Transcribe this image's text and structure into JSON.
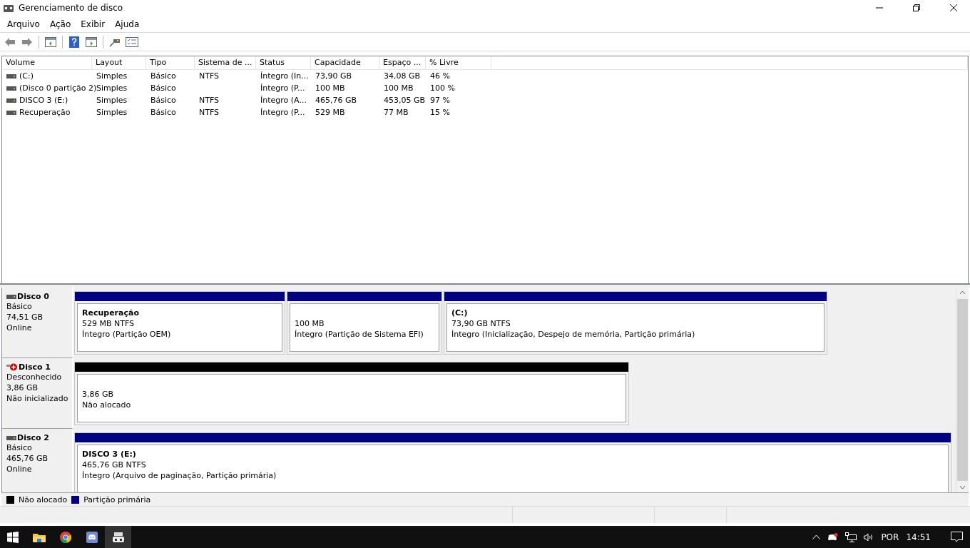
{
  "window": {
    "title": "Gerenciamento de disco"
  },
  "menu": [
    "Arquivo",
    "Ação",
    "Exibir",
    "Ajuda"
  ],
  "table": {
    "columns": [
      "Volume",
      "Layout",
      "Tipo",
      "Sistema de ...",
      "Status",
      "Capacidade",
      "Espaço ...",
      "% Livre"
    ],
    "rows": [
      [
        "(C:)",
        "Simples",
        "Básico",
        "NTFS",
        "Íntegro (In...",
        "73,90 GB",
        "34,08 GB",
        "46 %"
      ],
      [
        "(Disco 0 partição 2)",
        "Simples",
        "Básico",
        "",
        "Íntegro (P...",
        "100 MB",
        "100 MB",
        "100 %"
      ],
      [
        "DISCO 3 (E:)",
        "Simples",
        "Básico",
        "NTFS",
        "Íntegro (A...",
        "465,76 GB",
        "453,05 GB",
        "97 %"
      ],
      [
        "Recuperação",
        "Simples",
        "Básico",
        "NTFS",
        "Íntegro (P...",
        "529 MB",
        "77 MB",
        "15 %"
      ]
    ]
  },
  "disks": [
    {
      "name": "Disco 0",
      "kind": "ok",
      "lines": [
        "Básico",
        "74,51 GB",
        "Online"
      ],
      "partitions": [
        {
          "title": "Recuperação",
          "lines": [
            "529 MB NTFS",
            "Íntegro (Partição OEM)"
          ],
          "color": "#000080"
        },
        {
          "lines": [
            "100 MB",
            "Íntegro (Partição de Sistema EFI)"
          ],
          "color": "#000080"
        },
        {
          "title": "(C:)",
          "lines": [
            "73,90 GB NTFS",
            "Íntegro (Inicialização, Despejo de memória, Partição primária)"
          ],
          "color": "#000080"
        }
      ]
    },
    {
      "name": "Disco 1",
      "kind": "error",
      "lines": [
        "Desconhecido",
        "3,86 GB",
        "Não inicializado"
      ],
      "partitions": [
        {
          "lines": [
            "3,86 GB",
            "Não alocado"
          ],
          "color": "#000000"
        }
      ]
    },
    {
      "name": "Disco 2",
      "kind": "ok",
      "lines": [
        "Básico",
        "465,76 GB",
        "Online"
      ],
      "partitions": [
        {
          "title": "DISCO 3  (E:)",
          "lines": [
            "465,76 GB NTFS",
            "Íntegro (Arquivo de paginação, Partição primária)"
          ],
          "color": "#000080"
        }
      ]
    }
  ],
  "legend": [
    {
      "label": "Não alocado",
      "color": "#000000"
    },
    {
      "label": "Partição primária",
      "color": "#000080"
    }
  ],
  "taskbar": {
    "tray": {
      "language": "POR",
      "time": "14:51"
    }
  }
}
